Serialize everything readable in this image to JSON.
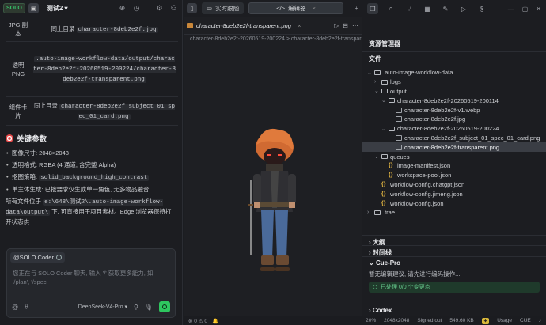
{
  "app": {
    "badge": "SOLO",
    "session_title": "测试2"
  },
  "chat": {
    "table": [
      {
        "key": "JPG 副本",
        "text": "同上目录",
        "code": "character-8deb2e2f.jpg"
      },
      {
        "key": "透明 PNG",
        "text": "",
        "code": ".auto-image-workflow-data/output/character-8deb2e2f-20260519-200224/character-8deb2e2f-transparent.png"
      },
      {
        "key": "组件卡片",
        "text": "同上目录",
        "code": "character-8deb2e2f_subject_01_spec_01_card.png"
      }
    ],
    "section_title": "关键参数",
    "params": [
      {
        "text": "图像尺寸: 2048×2048",
        "code": ""
      },
      {
        "text": "透明格式: RGBA (4 通道, 含完整 Alpha)",
        "code": ""
      },
      {
        "text": "抠图策略:",
        "code": "solid_background_high_contrast"
      },
      {
        "text": "单主体生成: 已按要求仅生成单一角色, 无多物品融合",
        "code": ""
      }
    ],
    "footer_prefix": "所有文件位于",
    "footer_code": "e:\\648\\测试2\\.auto-image-workflow-data\\output\\",
    "footer_suffix": "下, 可直接用于项目素材。Edge 浏览器保持打开状态供"
  },
  "input": {
    "mention": "@SOLO Coder",
    "placeholder": "您正在与 SOLO Coder 聊天, 输入 '/' 获取更多能力, 如 '/plan', '/spec'",
    "model": "DeepSeek-V4-Pro"
  },
  "editor": {
    "tabs": [
      {
        "label": "实时跟随"
      },
      {
        "label": "编辑器"
      }
    ],
    "file_tab": "character-8deb2e2f-transparent.png",
    "breadcrumb": "character-8deb2e2f-20260519-200224  >  character-8deb2e2f-transparen"
  },
  "explorer": {
    "title": "资源管理器",
    "files_label": "文件",
    "tree": [
      {
        "label": ".auto-image-workflow-data",
        "type": "folder",
        "depth": 0,
        "open": true
      },
      {
        "label": "logs",
        "type": "folder",
        "depth": 1,
        "open": false
      },
      {
        "label": "output",
        "type": "folder",
        "depth": 1,
        "open": true
      },
      {
        "label": "character-8deb2e2f-20260519-200114",
        "type": "folder",
        "depth": 2,
        "open": true
      },
      {
        "label": "character-8deb2e2f-v1.webp",
        "type": "image",
        "depth": 3
      },
      {
        "label": "character-8deb2e2f.jpg",
        "type": "image",
        "depth": 3
      },
      {
        "label": "character-8deb2e2f-20260519-200224",
        "type": "folder",
        "depth": 2,
        "open": true
      },
      {
        "label": "character-8deb2e2f_subject_01_spec_01_card.png",
        "type": "image",
        "depth": 3
      },
      {
        "label": "character-8deb2e2f-transparent.png",
        "type": "image",
        "depth": 3,
        "selected": true
      },
      {
        "label": "queues",
        "type": "folder",
        "depth": 1,
        "open": true
      },
      {
        "label": "image-manifest.json",
        "type": "json",
        "depth": 2
      },
      {
        "label": "workspace-pool.json",
        "type": "json",
        "depth": 2
      },
      {
        "label": "workflow-config.chatgpt.json",
        "type": "json",
        "depth": 1
      },
      {
        "label": "workflow-config.jimeng.json",
        "type": "json",
        "depth": 1
      },
      {
        "label": "workflow-config.json",
        "type": "json",
        "depth": 1
      },
      {
        "label": ".trae",
        "type": "folder",
        "depth": 0,
        "open": false
      }
    ],
    "outline": "大纲",
    "timeline": "时间线",
    "cue_pro": "Cue-Pro",
    "cue_text": "暂无编辑建议, 请先进行编码操作...",
    "cue_status": "已处理 0/0 个变更点",
    "codex": "Codex"
  },
  "status_bar": {
    "errors": "0",
    "warnings": "0",
    "zoom": "20%",
    "size": "2048x2048",
    "signed": "Signed out",
    "filesize": "549.60 KB",
    "usage": "Usage",
    "cue": "CUE"
  },
  "colors": {
    "accent_green": "#2ec65f",
    "selection": "#3a3d44",
    "background": "#1c1d21"
  }
}
